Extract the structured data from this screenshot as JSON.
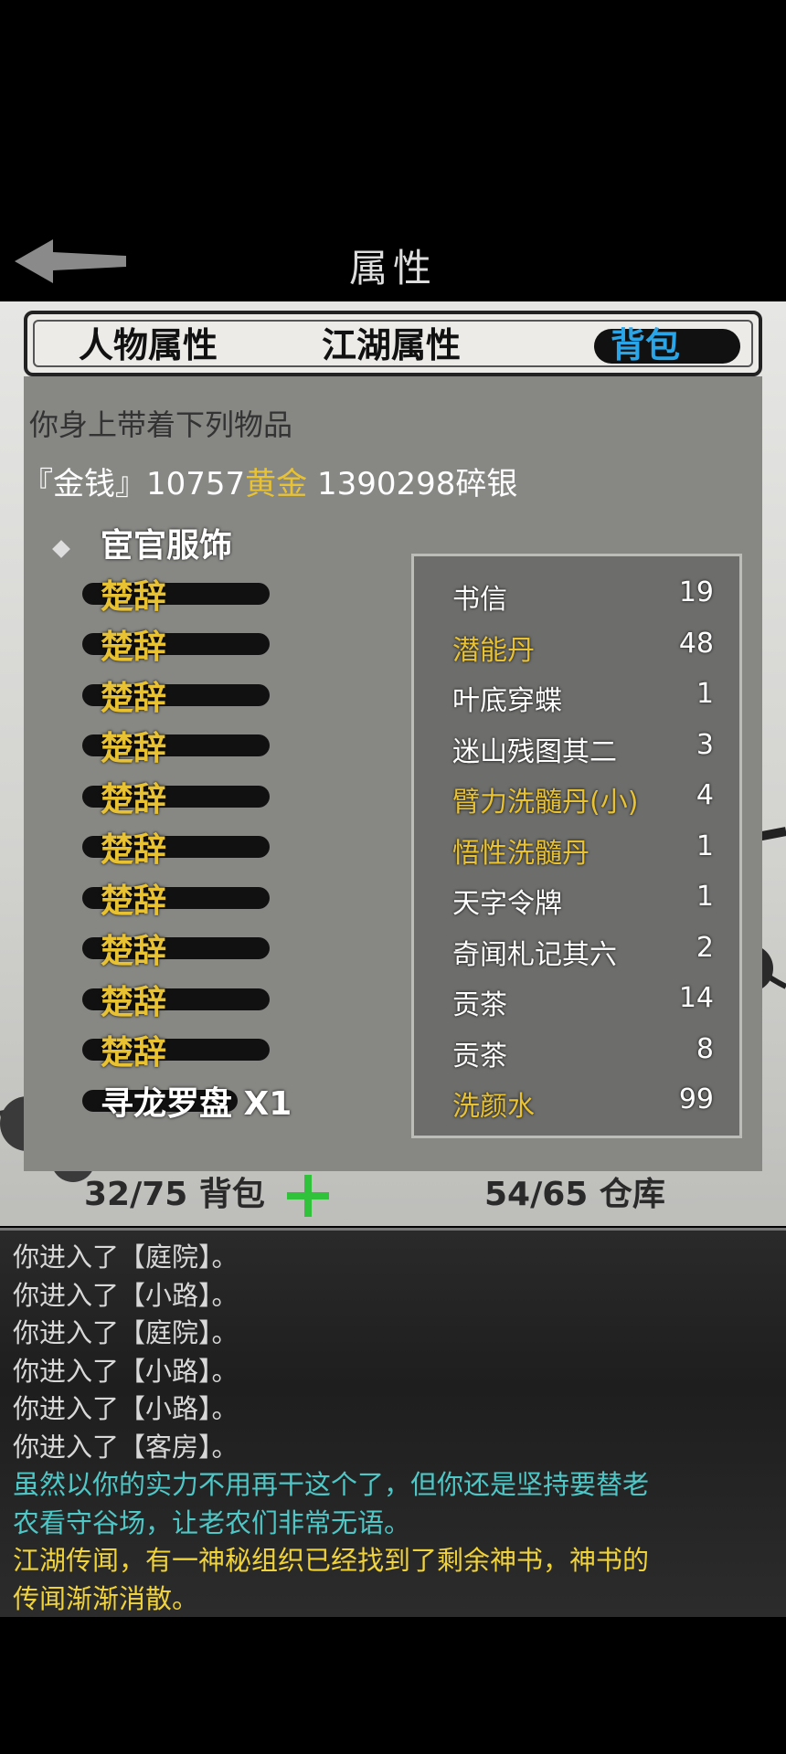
{
  "header": {
    "title": "属性",
    "back_icon": "back-arrow-icon"
  },
  "tabs": [
    {
      "label": "人物属性",
      "active": false
    },
    {
      "label": "江湖属性",
      "active": false
    },
    {
      "label": "背包",
      "active": true
    }
  ],
  "inventory": {
    "heading": "你身上带着下列物品",
    "money": {
      "prefix": "『金钱』",
      "gold_amount": "10757",
      "gold_unit": "黄金",
      "silver": "1390298碎银"
    },
    "items": [
      {
        "label": "宦官服饰",
        "color": "#ffffff"
      },
      {
        "label": "楚辞",
        "color": "#e8c232"
      },
      {
        "label": "楚辞",
        "color": "#e8c232"
      },
      {
        "label": "楚辞",
        "color": "#e8c232"
      },
      {
        "label": "楚辞",
        "color": "#e8c232"
      },
      {
        "label": "楚辞",
        "color": "#e8c232"
      },
      {
        "label": "楚辞",
        "color": "#e8c232"
      },
      {
        "label": "楚辞",
        "color": "#e8c232"
      },
      {
        "label": "楚辞",
        "color": "#e8c232"
      },
      {
        "label": "楚辞",
        "color": "#e8c232"
      },
      {
        "label": "楚辞",
        "color": "#e8c232"
      },
      {
        "label": "寻龙罗盘 X1",
        "color": "#ffffff"
      }
    ]
  },
  "popup": {
    "items": [
      {
        "name": "书信",
        "count": "19",
        "color": "#ffffff"
      },
      {
        "name": "潜能丹",
        "count": "48",
        "color": "#e8c232"
      },
      {
        "name": "叶底穿蝶",
        "count": "1",
        "color": "#ffffff"
      },
      {
        "name": "迷山残图其二",
        "count": "3",
        "color": "#ffffff"
      },
      {
        "name": "臂力洗髓丹(小)",
        "count": "4",
        "color": "#e8c232"
      },
      {
        "name": "悟性洗髓丹",
        "count": "1",
        "color": "#e8c232"
      },
      {
        "name": "天字令牌",
        "count": "1",
        "color": "#ffffff"
      },
      {
        "name": "奇闻札记其六",
        "count": "2",
        "color": "#ffffff"
      },
      {
        "name": "贡茶",
        "count": "14",
        "color": "#ffffff"
      },
      {
        "name": "贡茶",
        "count": "8",
        "color": "#ffffff"
      },
      {
        "name": "洗颜水",
        "count": "99",
        "color": "#e8c232"
      }
    ]
  },
  "footer": {
    "bag": "32/75 背包",
    "warehouse": "54/65 仓库",
    "add_icon": "plus-icon"
  },
  "log": [
    {
      "text": "你进入了【庭院】。",
      "color": "#d8d8d8"
    },
    {
      "text": "你进入了【小路】。",
      "color": "#d8d8d8"
    },
    {
      "text": "你进入了【庭院】。",
      "color": "#d8d8d8"
    },
    {
      "text": "你进入了【小路】。",
      "color": "#d8d8d8"
    },
    {
      "text": "你进入了【小路】。",
      "color": "#d8d8d8"
    },
    {
      "text": "你进入了【客房】。",
      "color": "#d8d8d8"
    },
    {
      "text": "虽然以你的实力不用再干这个了，但你还是坚持要替老",
      "color": "#4fc7c7"
    },
    {
      "text": "农看守谷场，让老农们非常无语。",
      "color": "#4fc7c7"
    },
    {
      "text": "江湖传闻，有一神秘组织已经找到了剩余神书，神书的",
      "color": "#f0d23a"
    },
    {
      "text": "传闻渐渐消散。",
      "color": "#f0d23a"
    }
  ]
}
